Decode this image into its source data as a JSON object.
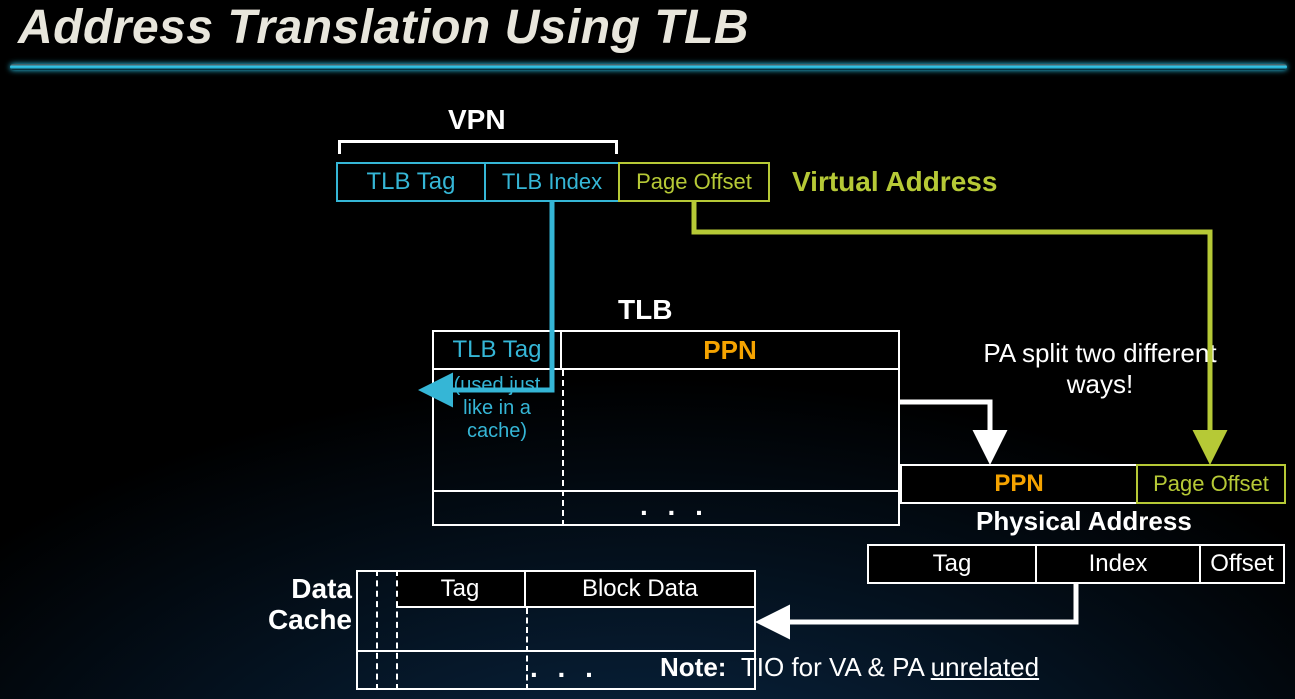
{
  "title": "Address Translation Using TLB",
  "vpn_label": "VPN",
  "va": {
    "tlb_tag": "TLB Tag",
    "tlb_index": "TLB Index",
    "page_offset": "Page Offset",
    "label": "Virtual Address"
  },
  "tlb": {
    "title": "TLB",
    "col_tag": "TLB Tag",
    "col_ppn": "PPN",
    "note": "(used just like in a cache)",
    "ellipsis": ". . ."
  },
  "pa_hint": "PA split two different ways!",
  "pa": {
    "ppn": "PPN",
    "page_offset": "Page Offset",
    "label": "Physical Address",
    "tag": "Tag",
    "index": "Index",
    "offset": "Offset"
  },
  "cache": {
    "label": "Data Cache",
    "col_tag": "Tag",
    "col_data": "Block Data",
    "ellipsis": ". . ."
  },
  "footer": {
    "note_bold": "Note:",
    "note_rest_a": "TIO for VA & PA ",
    "note_rest_u": "unrelated"
  }
}
